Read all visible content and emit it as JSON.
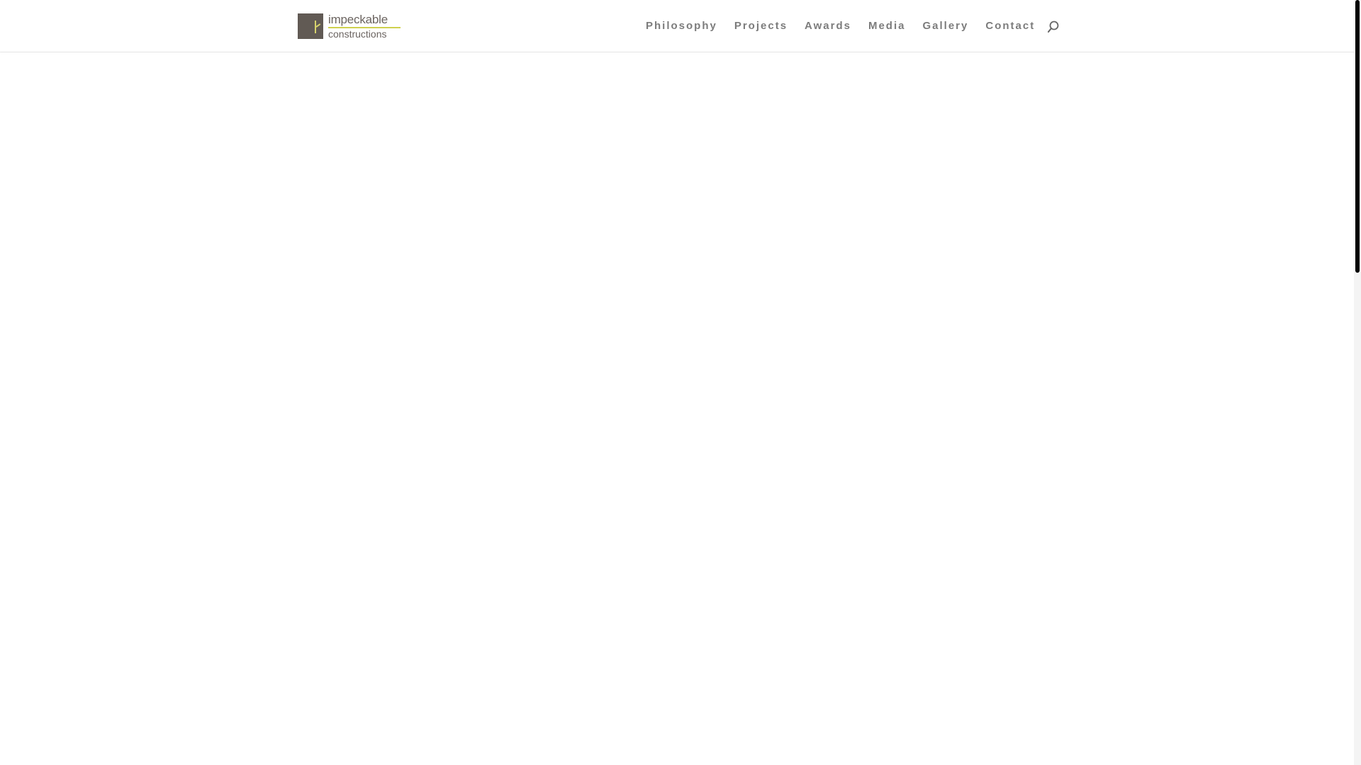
{
  "logo": {
    "line1": "impeckable",
    "line2": "constructions",
    "mark_color": "#615a54",
    "accent_color": "#cfd04f"
  },
  "nav": {
    "items": [
      {
        "label": "Philosophy"
      },
      {
        "label": "Projects"
      },
      {
        "label": "Awards"
      },
      {
        "label": "Media"
      },
      {
        "label": "Gallery"
      },
      {
        "label": "Contact"
      }
    ],
    "search_icon": "search-icon",
    "text_color": "#666666"
  },
  "scrollbar": {
    "thumb_color": "#000000"
  }
}
